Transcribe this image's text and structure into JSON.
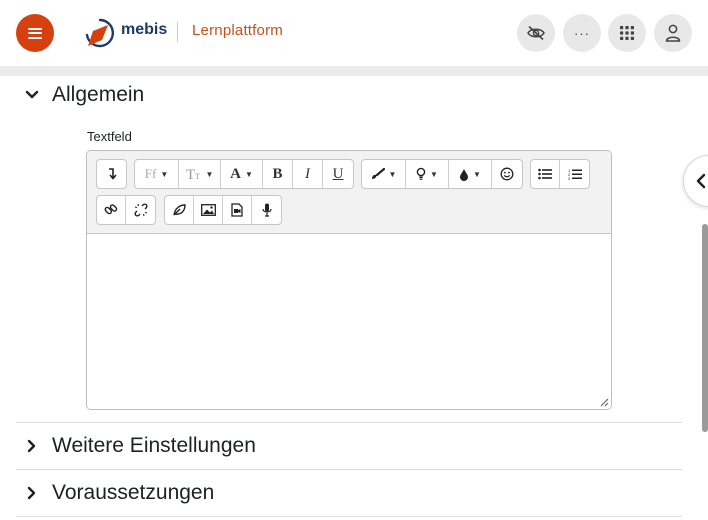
{
  "header": {
    "logo_text": "mebis",
    "platform_title": "Lernplattform",
    "menu_icon": "hamburger-icon",
    "buttons": [
      {
        "name": "hide-visibility-button",
        "icon": "eye-slash-icon"
      },
      {
        "name": "more-button",
        "icon": "more-dots-icon",
        "label": "···"
      },
      {
        "name": "apps-button",
        "icon": "grid-icon"
      },
      {
        "name": "user-button",
        "icon": "user-icon"
      }
    ],
    "accent_color": "#d6400e"
  },
  "sections": [
    {
      "title": "Allgemein",
      "expanded": true
    },
    {
      "title": "Weitere Einstellungen",
      "expanded": false
    },
    {
      "title": "Voraussetzungen",
      "expanded": false
    }
  ],
  "textfield": {
    "label": "Textfeld",
    "value": "",
    "toolbar": {
      "font_family_label": "Ff",
      "bold": "B",
      "italic": "I",
      "underline": "U",
      "font_size_icon": "text-size-icon",
      "font_color_label": "A"
    }
  }
}
